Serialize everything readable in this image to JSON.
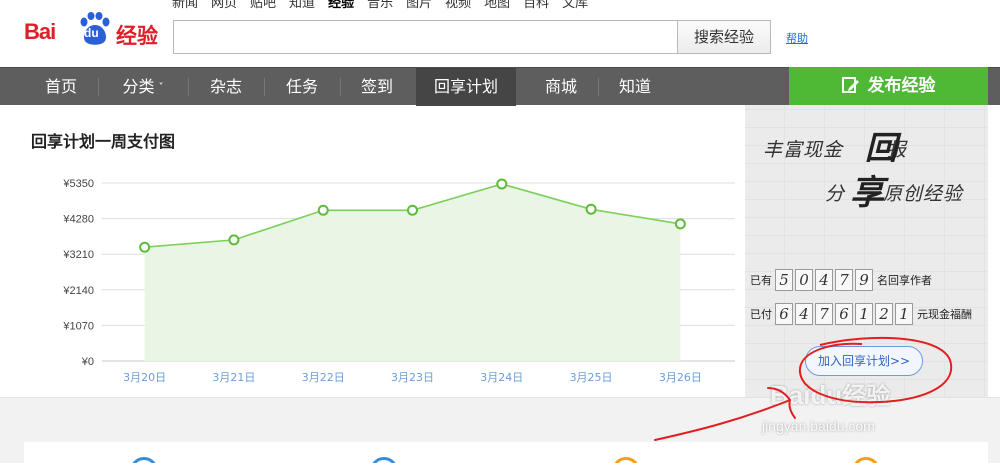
{
  "header": {
    "logo_text_left": "Bai",
    "logo_text_du": "du",
    "logo_text_right": "经验",
    "top_nav": [
      {
        "label": "新闻",
        "active": false
      },
      {
        "label": "网页",
        "active": false
      },
      {
        "label": "贴吧",
        "active": false
      },
      {
        "label": "知道",
        "active": false
      },
      {
        "label": "经验",
        "active": true
      },
      {
        "label": "音乐",
        "active": false
      },
      {
        "label": "图片",
        "active": false
      },
      {
        "label": "视频",
        "active": false
      },
      {
        "label": "地图",
        "active": false
      },
      {
        "label": "百科",
        "active": false
      },
      {
        "label": "文库",
        "active": false
      }
    ],
    "search_value": "",
    "search_button": "搜索经验",
    "help_link": "帮助"
  },
  "main_nav": {
    "items": [
      {
        "label": "首页",
        "active": false,
        "dropdown": false
      },
      {
        "label": "分类",
        "active": false,
        "dropdown": true
      },
      {
        "label": "杂志",
        "active": false,
        "dropdown": false
      },
      {
        "label": "任务",
        "active": false,
        "dropdown": false
      },
      {
        "label": "签到",
        "active": false,
        "dropdown": false
      },
      {
        "label": "回享计划",
        "active": true,
        "dropdown": false
      },
      {
        "label": "商城",
        "active": false,
        "dropdown": false
      },
      {
        "label": "知道",
        "active": false,
        "dropdown": false
      }
    ],
    "caret": "˅",
    "publish_button": "发布经验"
  },
  "chart_section": {
    "title": "回享计划一周支付图"
  },
  "chart_data": {
    "type": "area",
    "title": "回享计划一周支付图",
    "categories": [
      "3月20日",
      "3月21日",
      "3月22日",
      "3月23日",
      "3月24日",
      "3月25日",
      "3月26日"
    ],
    "values": [
      3420,
      3640,
      4530,
      4530,
      5320,
      4560,
      4120
    ],
    "y_ticks": [
      "¥0",
      "¥1070",
      "¥2140",
      "¥3210",
      "¥4280",
      "¥5350"
    ],
    "ylim": [
      0,
      5350
    ],
    "grid": true,
    "legend": "none",
    "line_color": "#7ccf5a",
    "fill_color": "#eaf6e5",
    "marker_stroke": "#5dbb3c",
    "axis_label_color": "#6a9fd8"
  },
  "promo": {
    "slogan_line1": "丰富现金",
    "slogan_big1": "回",
    "slogan_line1_end": "报",
    "slogan_line2_start": "分",
    "slogan_big2": "享",
    "slogan_line2": "原创经验",
    "authors_prefix": "已有",
    "authors_digits": [
      "5",
      "0",
      "4",
      "7",
      "9"
    ],
    "authors_suffix": "名回享作者",
    "paid_prefix": "已付",
    "paid_digits": [
      "6",
      "4",
      "7",
      "6",
      "1",
      "2",
      "1"
    ],
    "paid_suffix": "元现金福酬",
    "join_button": "加入回享计划>>"
  },
  "watermark": {
    "logo": "Bai",
    "logo_du": "du",
    "logo_jy": "经验",
    "url": "jingyan.baidu.com"
  },
  "colors": {
    "brand_red": "#de1f28",
    "nav_gray": "#5e5e5e",
    "publish_green": "#4fb834",
    "annotation_red": "#e0201f"
  }
}
